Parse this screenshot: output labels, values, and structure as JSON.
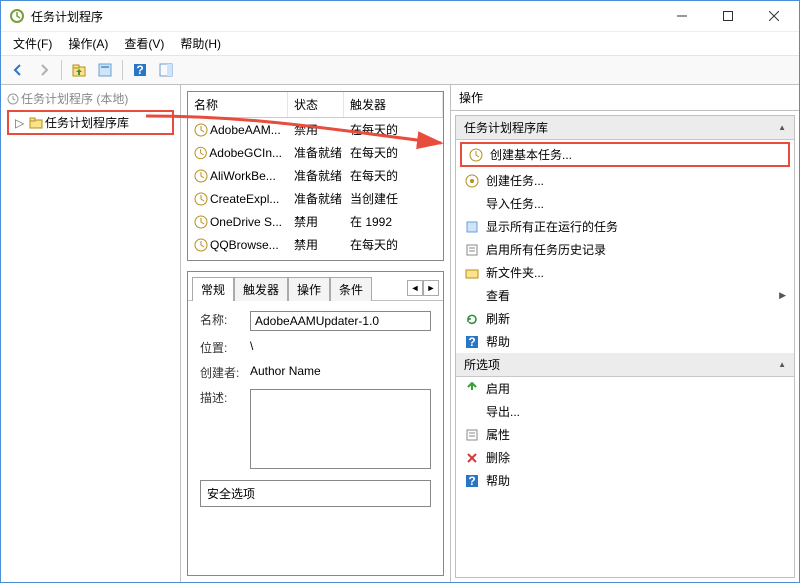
{
  "window": {
    "title": "任务计划程序"
  },
  "menu": {
    "file": "文件(F)",
    "action": "操作(A)",
    "view": "查看(V)",
    "help": "帮助(H)"
  },
  "tree": {
    "root": "任务计划程序 (本地)",
    "library": "任务计划程序库"
  },
  "list": {
    "cols": {
      "name": "名称",
      "state": "状态",
      "trigger": "触发器"
    },
    "rows": [
      {
        "name": "AdobeAAM...",
        "state": "禁用",
        "trigger": "在每天的"
      },
      {
        "name": "AdobeGCIn...",
        "state": "准备就绪",
        "trigger": "在每天的"
      },
      {
        "name": "AliWorkBe...",
        "state": "准备就绪",
        "trigger": "在每天的"
      },
      {
        "name": "CreateExpl...",
        "state": "准备就绪",
        "trigger": "当创建任"
      },
      {
        "name": "OneDrive S...",
        "state": "禁用",
        "trigger": "在 1992"
      },
      {
        "name": "QQBrowse...",
        "state": "禁用",
        "trigger": "在每天的"
      }
    ]
  },
  "detail": {
    "tabs": {
      "general": "常规",
      "triggers": "触发器",
      "actions": "操作",
      "conditions": "条件"
    },
    "fields": {
      "name_label": "名称:",
      "name_value": "AdobeAAMUpdater-1.0",
      "location_label": "位置:",
      "location_value": "\\",
      "author_label": "创建者:",
      "author_value": "Author Name",
      "desc_label": "描述:",
      "desc_value": "",
      "security_label": "安全选项"
    }
  },
  "actions": {
    "header": "操作",
    "group1": "任务计划程序库",
    "g1": {
      "create_basic": "创建基本任务...",
      "create": "创建任务...",
      "import": "导入任务...",
      "show_running": "显示所有正在运行的任务",
      "enable_history": "启用所有任务历史记录",
      "new_folder": "新文件夹...",
      "view": "查看",
      "refresh": "刷新",
      "help": "帮助"
    },
    "group2": "所选项",
    "g2": {
      "enable": "启用",
      "export": "导出...",
      "properties": "属性",
      "delete": "删除",
      "help": "帮助"
    }
  }
}
